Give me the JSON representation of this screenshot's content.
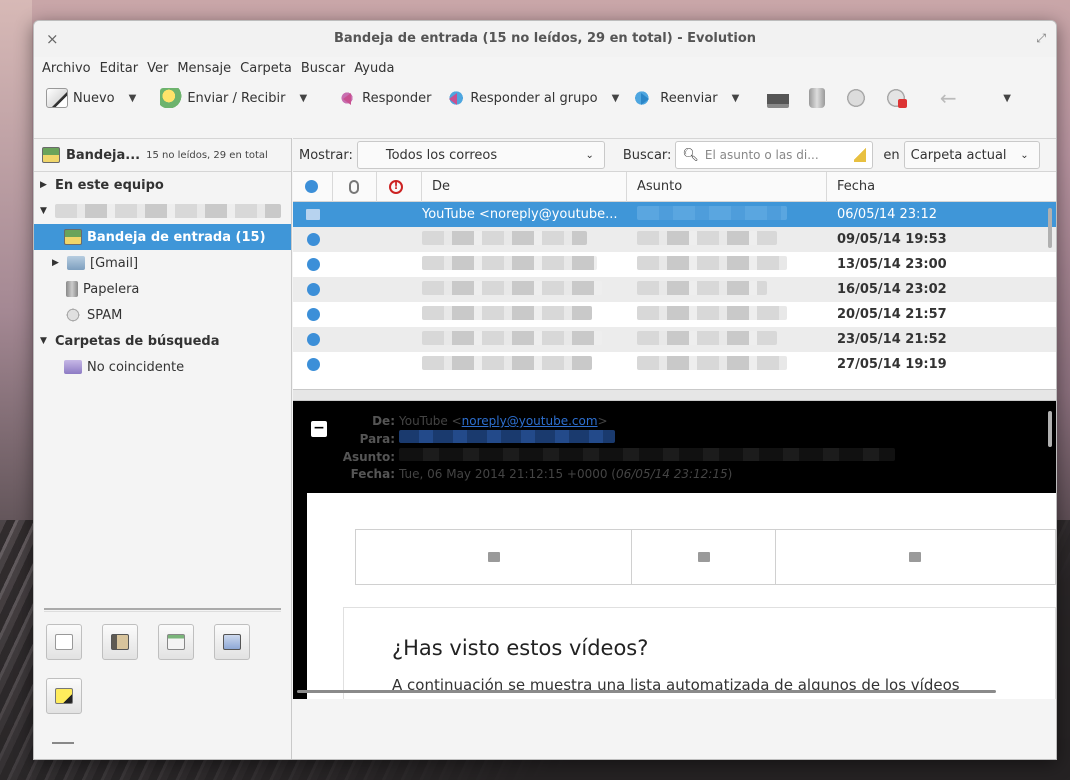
{
  "window": {
    "title": "Bandeja de entrada (15 no leídos, 29 en total) - Evolution",
    "close_glyph": "×",
    "max_glyph": "⤢"
  },
  "menubar": [
    "Archivo",
    "Editar",
    "Ver",
    "Mensaje",
    "Carpeta",
    "Buscar",
    "Ayuda"
  ],
  "toolbar": {
    "new_label": "Nuevo",
    "sendrecv_label": "Enviar / Recibir",
    "reply_label": "Responder",
    "replyall_label": "Responder al grupo",
    "forward_label": "Reenviar"
  },
  "sidebar": {
    "header_name": "Bandeja...",
    "header_count": "15 no leídos, 29 en total",
    "on_this_computer": "En este equipo",
    "inbox_label": "Bandeja de entrada (15)",
    "gmail_label": "[Gmail]",
    "trash_label": "Papelera",
    "spam_label": "SPAM",
    "search_folders_label": "Carpetas de búsqueda",
    "unmatched_label": "No coincidente"
  },
  "filter": {
    "show_label": "Mostrar:",
    "show_value": "Todos los correos",
    "search_label": "Buscar:",
    "search_placeholder": "El asunto o las di...",
    "in_label": "en",
    "scope_value": "Carpeta actual"
  },
  "list": {
    "columns": {
      "from": "De",
      "subject": "Asunto",
      "date": "Fecha"
    },
    "rows": [
      {
        "from": "YouTube <noreply@youtube...",
        "date": "06/05/14 23:12",
        "selected": true,
        "read": true
      },
      {
        "from": "",
        "date": "09/05/14 19:53",
        "selected": false,
        "read": false
      },
      {
        "from": "",
        "date": "13/05/14 23:00",
        "selected": false,
        "read": false
      },
      {
        "from": "",
        "date": "16/05/14 23:02",
        "selected": false,
        "read": false
      },
      {
        "from": "",
        "date": "20/05/14 21:57",
        "selected": false,
        "read": false
      },
      {
        "from": "",
        "date": "23/05/14 21:52",
        "selected": false,
        "read": false
      },
      {
        "from": "",
        "date": "27/05/14 19:19",
        "selected": false,
        "read": false
      }
    ]
  },
  "preview": {
    "toggle": "−",
    "from_key": "De:",
    "from_name": "YouTube <",
    "from_email": "noreply@youtube.com",
    "from_close": ">",
    "to_key": "Para:",
    "subject_key": "Asunto:",
    "date_key": "Fecha:",
    "date_value": "Tue, 06 May 2014 21:12:15 +0000 (",
    "date_local": "06/05/14 23:12:15",
    "date_close": ")",
    "heading": "¿Has visto estos vídeos?",
    "body_text": "A continuación se muestra una lista automatizada de algunos de los vídeos"
  },
  "colors": {
    "selection": "#3f96d8",
    "unread_dot": "#3c8fd8"
  }
}
